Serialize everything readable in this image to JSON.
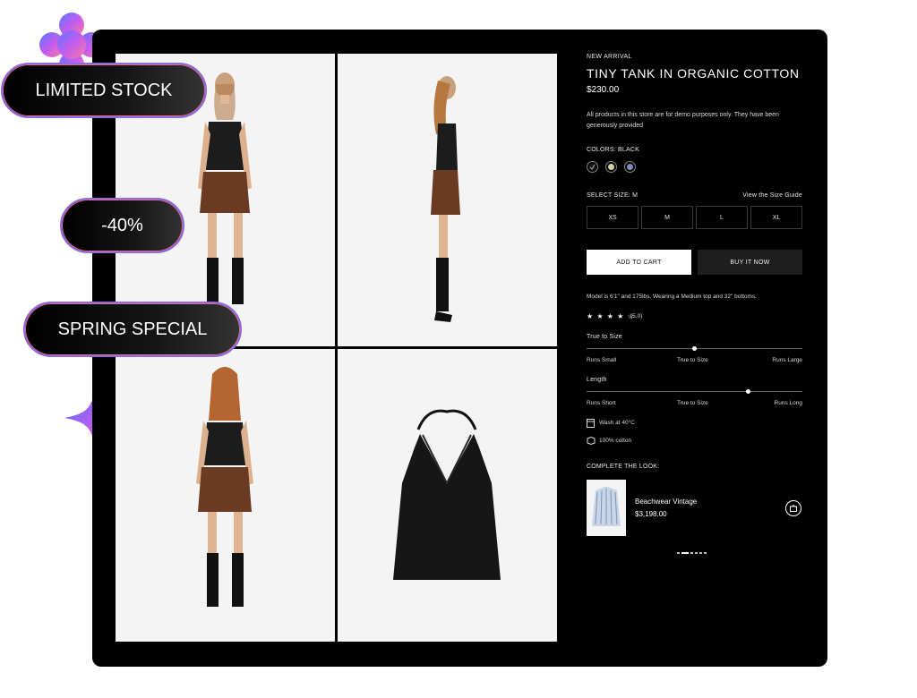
{
  "badges": {
    "limited": "LIMITED STOCK",
    "discount": "-40%",
    "spring": "SPRING SPECIAL"
  },
  "product": {
    "eyebrow": "NEW ARRIVAL",
    "title": "TINY TANK IN ORGANIC COTTON",
    "price": "$230.00",
    "note": "All products in this store are for demo purposes only. They have been generously provided",
    "colors_label": "COLORS: BLACK",
    "swatches": [
      "#1c1c1c",
      "#d8d2a0",
      "#7d8db8"
    ],
    "size_label": "SELECT SIZE: M",
    "size_guide": "View the Size Guide",
    "sizes": [
      "XS",
      "M",
      "L",
      "XL"
    ],
    "add_to_cart": "ADD TO CART",
    "buy_now": "BUY IT NOW",
    "model_info": "Model is 6'1\" and 175lbs. Wearing a Medium top and 32\" bottoms.",
    "stars": "★ ★ ★ ★ ☆",
    "rating": "(5.0)",
    "fit": {
      "title": "True to Size",
      "left": "Runs Small",
      "middle": "True to Size",
      "right": "Runs Large",
      "level": 0.5
    },
    "length": {
      "title": "Length",
      "left": "Runs Short",
      "middle": "True to Size",
      "right": "Runs Long",
      "level": 0.75
    },
    "care": "Wash at 40°C",
    "material": "100% cotton",
    "complete_look": "COMPLETE THE LOOK:",
    "look_item": {
      "name": "Beachwear Vintage",
      "price": "$3,198.00"
    }
  },
  "icons": [
    "check-icon",
    "washing-icon",
    "fabric-icon",
    "cart-icon",
    "star-icon"
  ]
}
